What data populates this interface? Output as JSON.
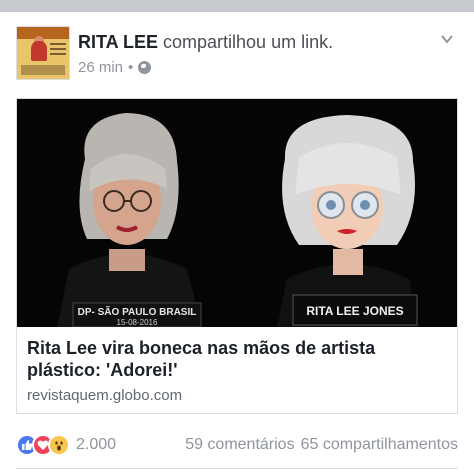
{
  "post": {
    "author": "RITA LEE",
    "action": "compartilhou um link.",
    "time": "26 min",
    "separator": "•",
    "privacy_icon": "globe-icon",
    "menu_icon": "chevron-down-icon"
  },
  "link": {
    "image_captions": {
      "left_sign": "DP- SÃO PAULO BRASIL",
      "left_date": "15-08-2016",
      "right_sign": "RITA LEE JONES"
    },
    "title": "Rita Lee vira boneca nas mãos de artista plástico: 'Adorei!'",
    "domain": "revistaquem.globo.com"
  },
  "footer": {
    "reaction_icons": [
      "like-icon",
      "love-icon",
      "wow-icon"
    ],
    "reaction_count": "2.000",
    "comments": "59 comentários",
    "shares": "65 compartilhamentos"
  },
  "colors": {
    "brand_blue": "#4b78ef",
    "love_red": "#f0435b",
    "wow_yellow": "#f7c64d",
    "meta_gray": "#90949c"
  }
}
